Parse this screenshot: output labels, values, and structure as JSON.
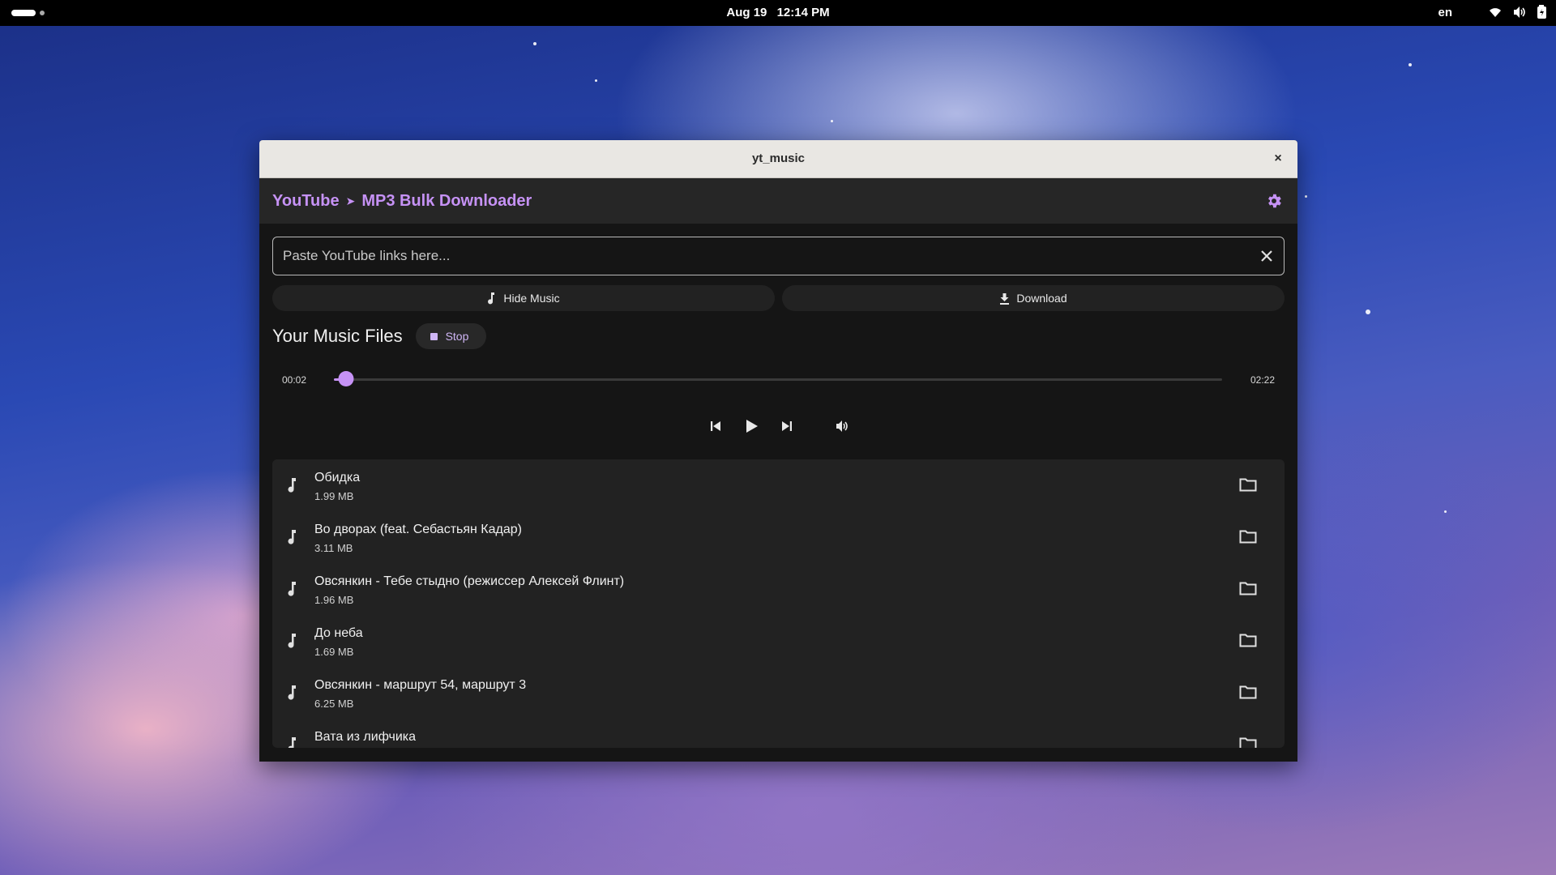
{
  "topbar": {
    "date": "Aug 19",
    "time": "12:14 PM",
    "language": "en"
  },
  "window": {
    "title": "yt_music",
    "close_label": "×"
  },
  "app": {
    "brand_part1": "YouTube",
    "brand_separator": "➤",
    "brand_part2": "MP3 Bulk Downloader",
    "accent_color": "#c692f5",
    "link_placeholder": "Paste YouTube links here...",
    "hide_music_label": "Hide Music",
    "download_label": "Download",
    "section_title": "Your Music Files",
    "stop_label": "Stop"
  },
  "player": {
    "current_time": "00:02",
    "total_time": "02:22",
    "progress_fraction": 0.014
  },
  "files": [
    {
      "name": "Обидка",
      "size": "1.99 MB"
    },
    {
      "name": "Во дворах (feat. Себастьян Кадар)",
      "size": "3.11 MB"
    },
    {
      "name": "Овсянкин - Тебе стыдно (режиссер Алексей Флинт)",
      "size": "1.96 MB"
    },
    {
      "name": "До неба",
      "size": "1.69 MB"
    },
    {
      "name": "Овсянкин - маршрут 54, маршрут 3",
      "size": "6.25 MB"
    },
    {
      "name": "Вата из лифчика",
      "size": ""
    }
  ]
}
